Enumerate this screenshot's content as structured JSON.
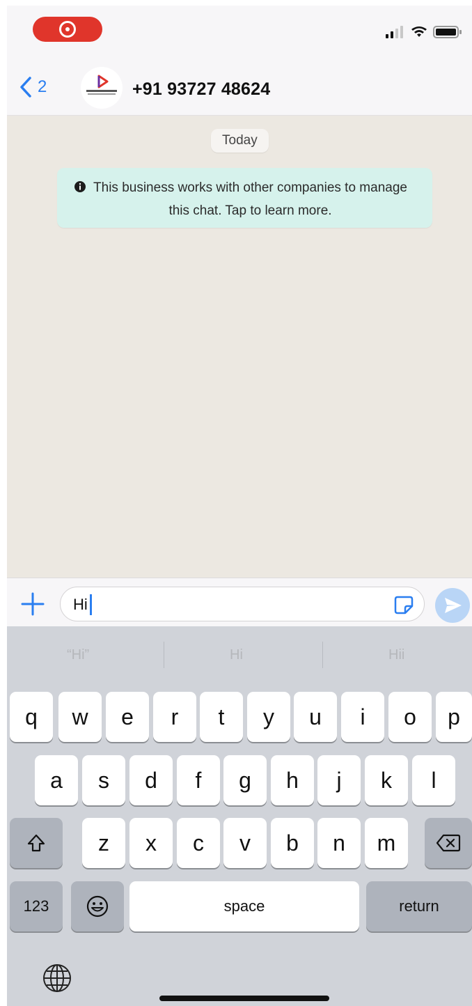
{
  "status_bar": {
    "signal_icon": "signal-bars-icon",
    "wifi_icon": "wifi-icon",
    "battery_icon": "battery-icon",
    "recording_icon": "screen-recording-icon"
  },
  "header": {
    "back_count": "2",
    "contact_name": "+91 93727 48624",
    "avatar_logo": "routemobile"
  },
  "chat": {
    "date_chip": "Today",
    "info_message": "This business works with other companies to manage this chat. Tap to learn more."
  },
  "input": {
    "value": "Hi"
  },
  "keyboard": {
    "suggestions": [
      "“Hi”",
      "Hi",
      "Hii"
    ],
    "row1": [
      "q",
      "w",
      "e",
      "r",
      "t",
      "y",
      "u",
      "i",
      "o",
      "p"
    ],
    "row2": [
      "a",
      "s",
      "d",
      "f",
      "g",
      "h",
      "j",
      "k",
      "l"
    ],
    "row3": [
      "z",
      "x",
      "c",
      "v",
      "b",
      "n",
      "m"
    ],
    "numbers_label": "123",
    "space_label": "space",
    "return_label": "return"
  },
  "colors": {
    "accent": "#2a7ef0",
    "recording": "#e0352b",
    "info_bubble": "#d6f2ec",
    "chat_background": "#ece8e1"
  }
}
